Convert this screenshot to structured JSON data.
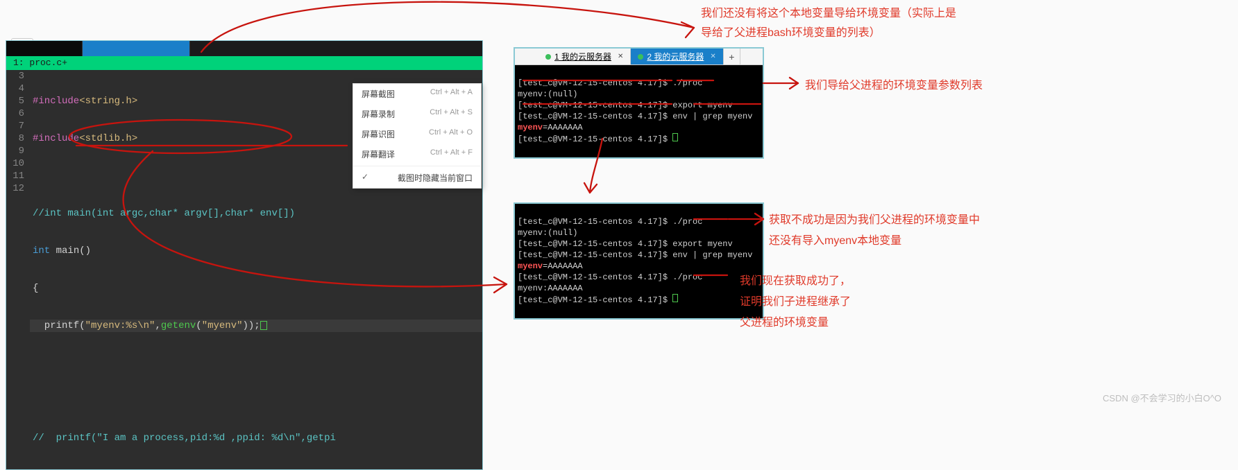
{
  "editor": {
    "filetab": "1: proc.c+",
    "gutter_start": 3,
    "lines": {
      "l3": "#include<string.h>",
      "l4": "#include<stdlib.h>",
      "l5": "",
      "l6": "//int main(int argc,char* argv[],char* env[])",
      "l7": "int main()",
      "l8": "{",
      "l9a": "  printf(",
      "l9b": "\"myenv:%s\\n\"",
      "l9c": ",",
      "l9d": "getenv",
      "l9e": "(",
      "l9f": "\"myenv\"",
      "l9g": "));",
      "l10": "",
      "l11": "",
      "l12": "//  printf(\"I am a process,pid:%d ,ppid: %d\\n\",getpi"
    }
  },
  "ctxmenu": {
    "item1": "屏幕截图",
    "sc1": "Ctrl + Alt + A",
    "item2": "屏幕录制",
    "sc2": "Ctrl + Alt + S",
    "item3": "屏幕识图",
    "sc3": "Ctrl + Alt + O",
    "item4": "屏幕翻译",
    "sc4": "Ctrl + Alt + F",
    "item5": "截图时隐藏当前窗口"
  },
  "termtabs": {
    "tab1": "1 我的云服务器",
    "tab2": "2 我的云服务器"
  },
  "term1": {
    "l1": "[test_c@VM-12-15-centos 4.17]$ ./proc",
    "l2": "myenv:(null)",
    "l3": "[test_c@VM-12-15-centos 4.17]$ export myenv",
    "l4": "[test_c@VM-12-15-centos 4.17]$ env | grep myenv",
    "l5a": "myenv",
    "l5b": "=AAAAAAA",
    "l6": "[test_c@VM-12-15-centos 4.17]$ "
  },
  "term2": {
    "l1": "[test_c@VM-12-15-centos 4.17]$ ./proc",
    "l2": "myenv:(null)",
    "l3": "[test_c@VM-12-15-centos 4.17]$ export myenv",
    "l4": "[test_c@VM-12-15-centos 4.17]$ env | grep myenv",
    "l5a": "myenv",
    "l5b": "=AAAAAAA",
    "l6": "[test_c@VM-12-15-centos 4.17]$ ./proc",
    "l7": "myenv:AAAAAAA",
    "l8": "[test_c@VM-12-15-centos 4.17]$ "
  },
  "anno": {
    "a1": "我们还没有将这个本地变量导给环境变量（实际上是",
    "a1b": "导给了父进程bash环境变量的列表）",
    "a2": "我们导给父进程的环境变量参数列表",
    "a3": "获取不成功是因为我们父进程的环境变量中",
    "a3b": "还没有导入myenv本地变量",
    "a4": "我们现在获取成功了，",
    "a4b": "证明我们子进程继承了",
    "a4c": "父进程的环境变量"
  },
  "watermark": "CSDN @不会学习的小白O^O"
}
